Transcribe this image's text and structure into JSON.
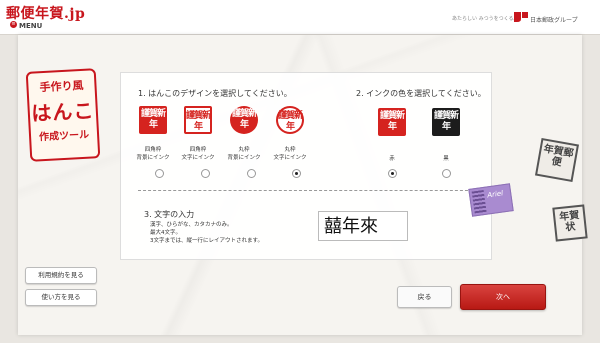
{
  "header": {
    "logo_text": "郵便年賀.jp",
    "menu_label": "MENU",
    "tagline": "あたらしい みつうをつくる。",
    "org_name": "日本郵政グループ"
  },
  "tool_title": {
    "line1": "手作り風",
    "line2": "はんこ",
    "line3": "作成ツール"
  },
  "design_section": {
    "title": "1. はんこのデザインを選択してください。",
    "options": [
      {
        "caption1": "四角枠",
        "caption2": "背景にインク",
        "stamp_text": "謹賀新年",
        "selected": false
      },
      {
        "caption1": "四角枠",
        "caption2": "文字にインク",
        "stamp_text": "謹賀新年",
        "selected": false
      },
      {
        "caption1": "丸枠",
        "caption2": "背景にインク",
        "stamp_text": "謹賀新年",
        "selected": false
      },
      {
        "caption1": "丸枠",
        "caption2": "文字にインク",
        "stamp_text": "謹賀新年",
        "selected": true
      }
    ]
  },
  "ink_section": {
    "title": "2. インクの色を選択してください。",
    "options": [
      {
        "label": "赤",
        "stamp_text": "謹賀新年",
        "selected": true
      },
      {
        "label": "黒",
        "stamp_text": "謹賀新年",
        "selected": false
      }
    ]
  },
  "text_section": {
    "title": "3. 文字の入力",
    "instructions": [
      "漢字、ひらがな、カタカナのみ。",
      "最大4文字。",
      "3文字までは、縦一行にレイアウトされます。"
    ],
    "input_value": "囍年來"
  },
  "ariel_tag": "Ariel",
  "deco_stamps": {
    "a": "年賀郵便",
    "b": "年賀状"
  },
  "buttons": {
    "terms": "利用規約を見る",
    "howto": "使い方を見る",
    "back": "戻る",
    "next": "次へ"
  },
  "colors": {
    "accent_red": "#c8161d",
    "ink_red": "#d5231f",
    "ink_black": "#1c1c1c"
  }
}
